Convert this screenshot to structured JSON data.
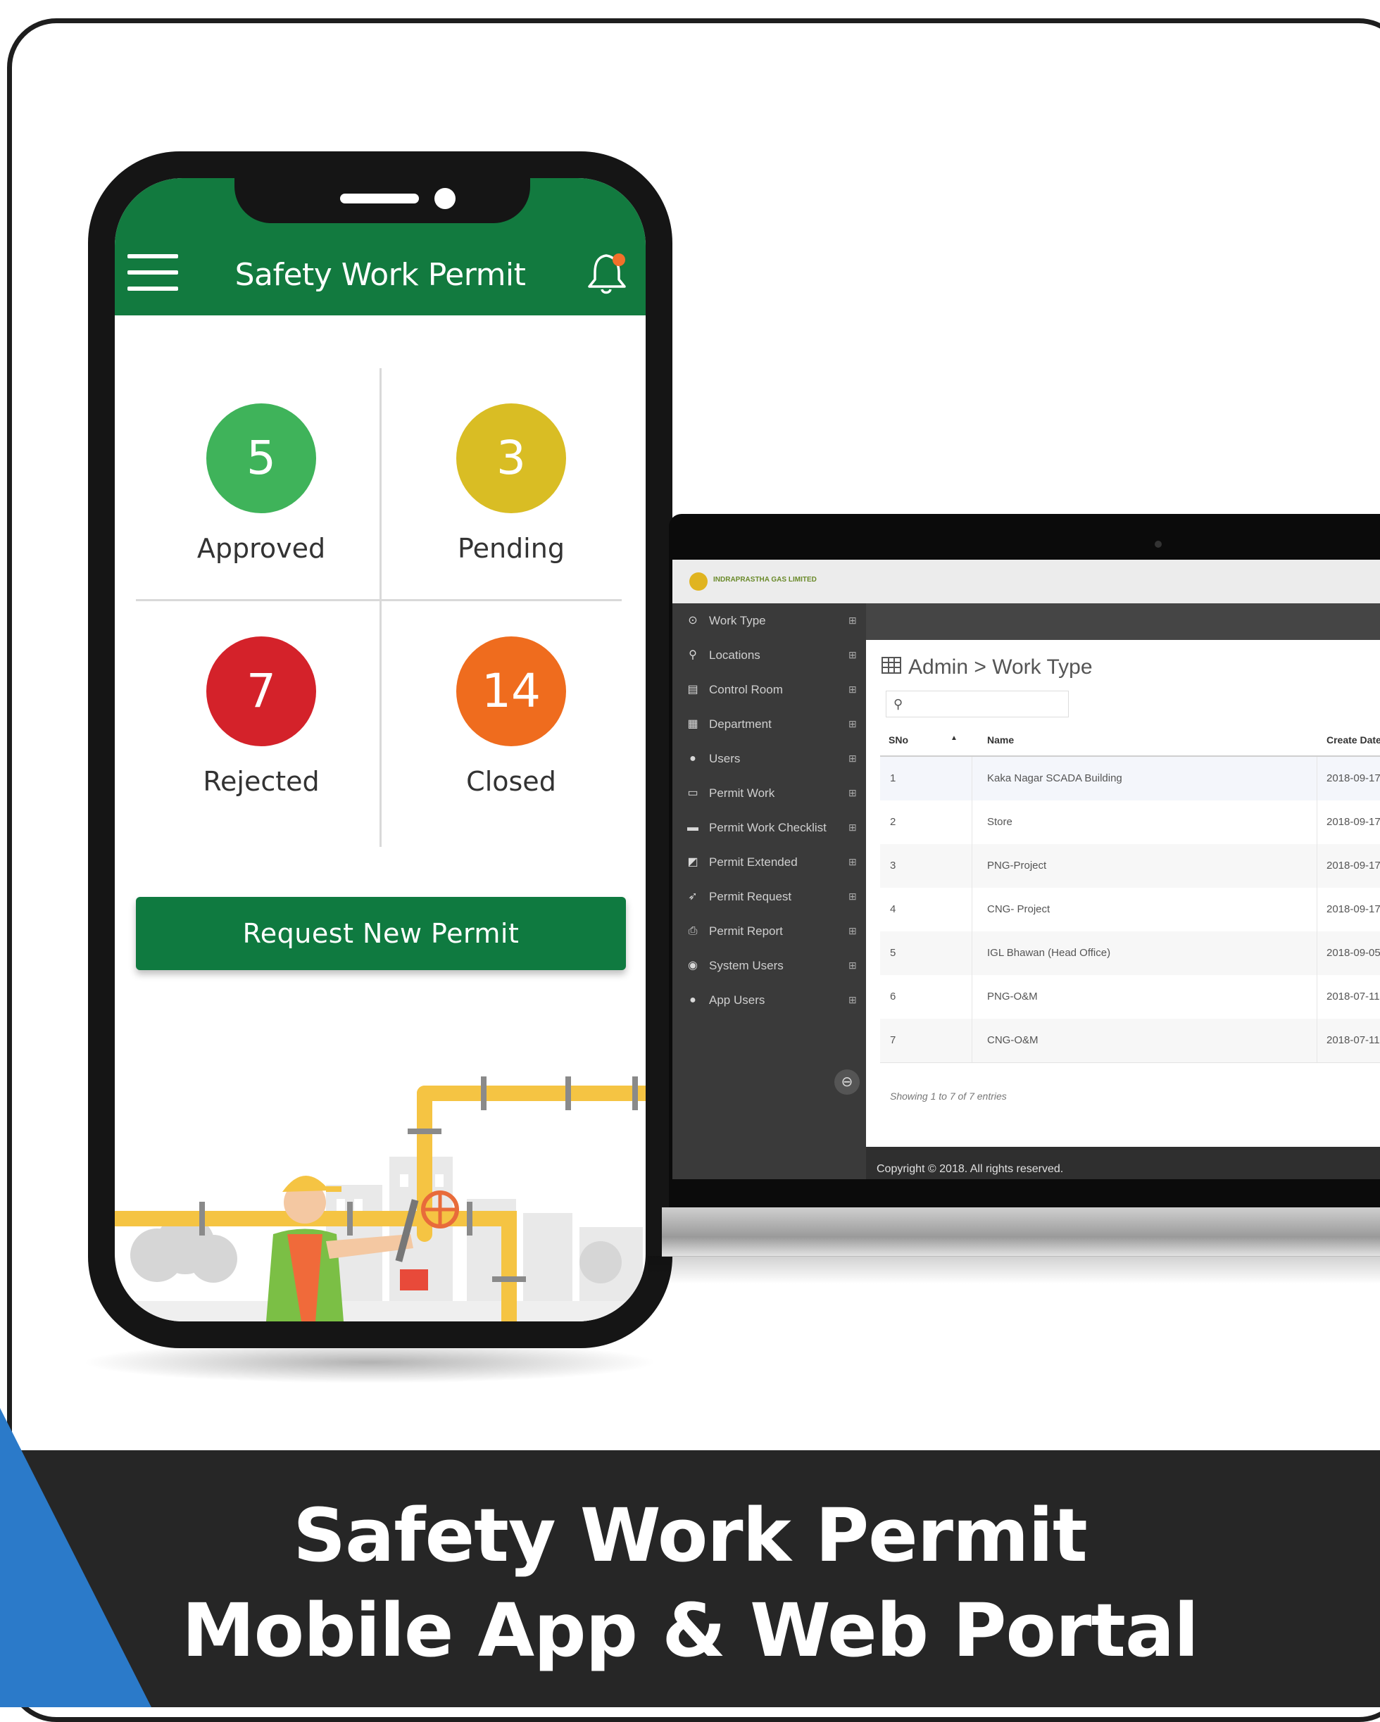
{
  "banner": {
    "line1": "Safety Work Permit",
    "line2": "Mobile App & Web Portal"
  },
  "colors": {
    "app_green": "#127a3f",
    "approved": "#3fb35a",
    "pending": "#d9bd24",
    "rejected": "#d4222a",
    "closed": "#ef6c1e",
    "banner_bg": "#262626",
    "accent_blue": "#2b7ac9"
  },
  "mobile": {
    "header_title": "Safety Work Permit",
    "menu_icon": "hamburger-icon",
    "notification_icon": "bell-icon",
    "stats": [
      {
        "count": "5",
        "label": "Approved"
      },
      {
        "count": "3",
        "label": "Pending"
      },
      {
        "count": "7",
        "label": "Rejected"
      },
      {
        "count": "14",
        "label": "Closed"
      }
    ],
    "request_button": "Request New Permit"
  },
  "web": {
    "logo_text": "INDRAPRASTHA GAS LIMITED",
    "breadcrumb": "Admin > Work Type",
    "sidebar": [
      {
        "icon": "clock-icon",
        "label": "Work Type"
      },
      {
        "icon": "map-marker-icon",
        "label": "Locations"
      },
      {
        "icon": "building-icon",
        "label": "Control Room"
      },
      {
        "icon": "department-icon",
        "label": "Department"
      },
      {
        "icon": "user-icon",
        "label": "Users"
      },
      {
        "icon": "id-card-icon",
        "label": "Permit Work"
      },
      {
        "icon": "briefcase-icon",
        "label": "Permit Work Checklist"
      },
      {
        "icon": "external-link-icon",
        "label": "Permit Extended"
      },
      {
        "icon": "rocket-icon",
        "label": "Permit Request"
      },
      {
        "icon": "print-icon",
        "label": "Permit Report"
      },
      {
        "icon": "users-icon",
        "label": "System Users"
      },
      {
        "icon": "user-icon",
        "label": "App Users"
      }
    ],
    "table": {
      "headers": [
        "SNo",
        "Name",
        "Create Date"
      ],
      "rows": [
        [
          "1",
          "Kaka Nagar SCADA Building",
          "2018-09-17"
        ],
        [
          "2",
          "Store",
          "2018-09-17"
        ],
        [
          "3",
          "PNG-Project",
          "2018-09-17"
        ],
        [
          "4",
          "CNG- Project",
          "2018-09-17"
        ],
        [
          "5",
          "IGL Bhawan (Head Office)",
          "2018-09-05"
        ],
        [
          "6",
          "PNG-O&M",
          "2018-07-11"
        ],
        [
          "7",
          "CNG-O&M",
          "2018-07-11"
        ]
      ],
      "summary": "Showing 1 to 7 of 7 entries"
    },
    "footer": "Copyright © 2018. All rights reserved."
  }
}
